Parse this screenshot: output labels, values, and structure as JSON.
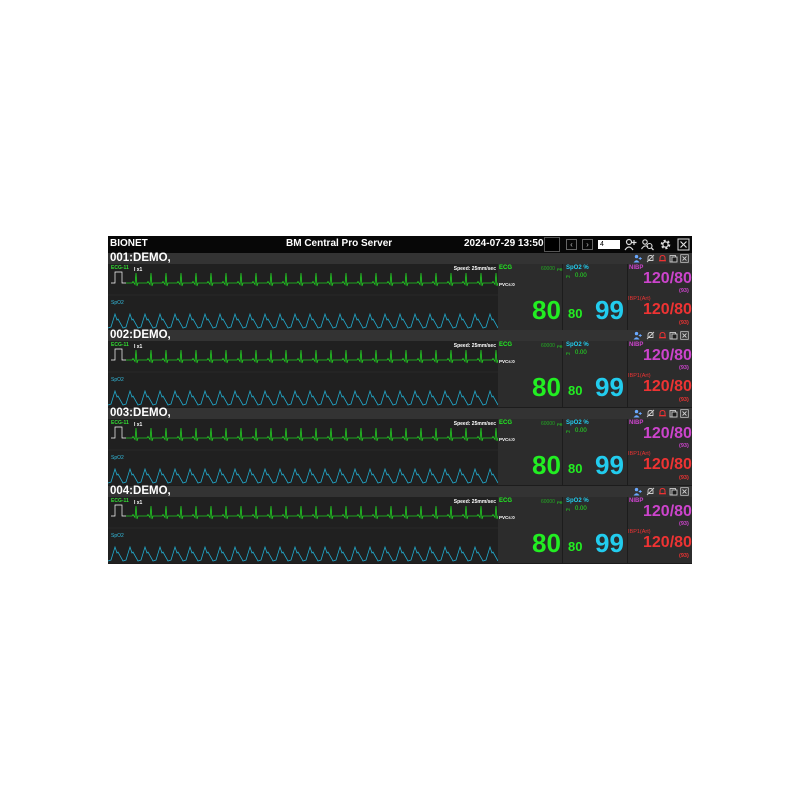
{
  "app": {
    "brand": "BIONET",
    "title": "BM Central Pro Server",
    "datetime": "2024-07-29 13:50",
    "page_number": "4",
    "icons": [
      "chevron-left-icon",
      "chevron-right-icon",
      "add-patient-icon",
      "search-patient-icon",
      "gear-icon",
      "close-icon"
    ]
  },
  "colors": {
    "ecg": "#22ee22",
    "spo2": "#22ccee",
    "nibp": "#cc44cc",
    "ibp": "#ee3333"
  },
  "beds": [
    {
      "name": "001:DEMO,",
      "ecg_label": "ECG-11",
      "gain": "I x1",
      "speed": "Speed: 25mm/sec",
      "spo2_wave_label": "SpO2",
      "ecg": {
        "label": "ECG",
        "code": "60000",
        "unit": "PR",
        "pvc": "PVCs:0",
        "hr": "80"
      },
      "spo2": {
        "label": "SpO2 %",
        "pi_label": "PI",
        "pi": "0.00",
        "pr": "80",
        "value": "99"
      },
      "nibp": {
        "label": "NIBP",
        "value": "120/80",
        "mean": "(93)"
      },
      "ibp": {
        "label": "IBP1(Art)",
        "value": "120/80",
        "mean": "(93)"
      }
    },
    {
      "name": "002:DEMO,",
      "ecg_label": "ECG-11",
      "gain": "I x1",
      "speed": "Speed: 25mm/sec",
      "spo2_wave_label": "SpO2",
      "ecg": {
        "label": "ECG",
        "code": "60000",
        "unit": "PR",
        "pvc": "PVCs:0",
        "hr": "80"
      },
      "spo2": {
        "label": "SpO2 %",
        "pi_label": "PI",
        "pi": "0.00",
        "pr": "80",
        "value": "99"
      },
      "nibp": {
        "label": "NIBP",
        "value": "120/80",
        "mean": "(93)"
      },
      "ibp": {
        "label": "IBP1(Art)",
        "value": "120/80",
        "mean": "(93)"
      }
    },
    {
      "name": "003:DEMO,",
      "ecg_label": "ECG-11",
      "gain": "I x1",
      "speed": "Speed: 25mm/sec",
      "spo2_wave_label": "SpO2",
      "ecg": {
        "label": "ECG",
        "code": "60000",
        "unit": "PR",
        "pvc": "PVCs:0",
        "hr": "80"
      },
      "spo2": {
        "label": "SpO2 %",
        "pi_label": "PI",
        "pi": "0.00",
        "pr": "80",
        "value": "99"
      },
      "nibp": {
        "label": "NIBP",
        "value": "120/80",
        "mean": "(93)"
      },
      "ibp": {
        "label": "IBP1(Art)",
        "value": "120/80",
        "mean": "(93)"
      }
    },
    {
      "name": "004:DEMO,",
      "ecg_label": "ECG-11",
      "gain": "I x1",
      "speed": "Speed: 25mm/sec",
      "spo2_wave_label": "SpO2",
      "ecg": {
        "label": "ECG",
        "code": "60000",
        "unit": "PR",
        "pvc": "PVCs:0",
        "hr": "80"
      },
      "spo2": {
        "label": "SpO2 %",
        "pi_label": "PI",
        "pi": "0.00",
        "pr": "80",
        "value": "99"
      },
      "nibp": {
        "label": "NIBP",
        "value": "120/80",
        "mean": "(93)"
      },
      "ibp": {
        "label": "IBP1(Art)",
        "value": "120/80",
        "mean": "(93)"
      }
    }
  ]
}
